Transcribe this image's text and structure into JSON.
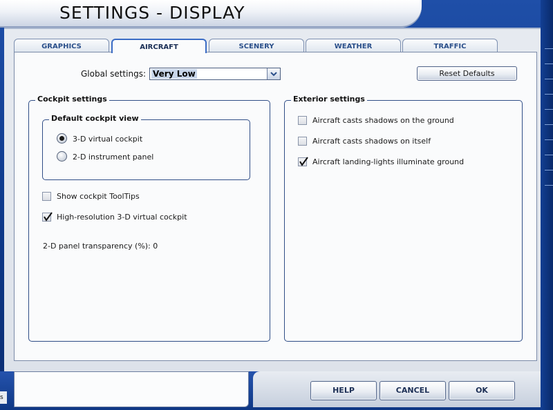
{
  "window": {
    "title": "SETTINGS - DISPLAY"
  },
  "tabs": [
    {
      "label": "GRAPHICS"
    },
    {
      "label": "AIRCRAFT"
    },
    {
      "label": "SCENERY"
    },
    {
      "label": "WEATHER"
    },
    {
      "label": "TRAFFIC"
    }
  ],
  "active_tab": "AIRCRAFT",
  "global": {
    "label": "Global settings:",
    "value": "Very Low"
  },
  "reset_label": "Reset Defaults",
  "cockpit": {
    "title": "Cockpit settings",
    "view_title": "Default cockpit view",
    "radio_3d": "3-D virtual cockpit",
    "radio_2d": "2-D instrument panel",
    "tooltips": "Show cockpit ToolTips",
    "hires": "High-resolution 3-D virtual cockpit",
    "transparency": "2-D panel transparency (%): 0"
  },
  "exterior": {
    "title": "Exterior settings",
    "shadows_ground": "Aircraft casts shadows on the ground",
    "shadows_self": "Aircraft casts shadows on itself",
    "landing_lights": "Aircraft landing-lights illuminate ground"
  },
  "buttons": {
    "help": "HELP",
    "cancel": "CANCEL",
    "ok": "OK"
  },
  "status_fragment": "s",
  "colors": {
    "frame_blue": "#0e3a8c",
    "panel": "#fafbfc",
    "active_tab_border": "#3b6cc5"
  },
  "icons": [
    "checkmark-icon",
    "chevron-down-icon",
    "radio-dot-icon"
  ]
}
